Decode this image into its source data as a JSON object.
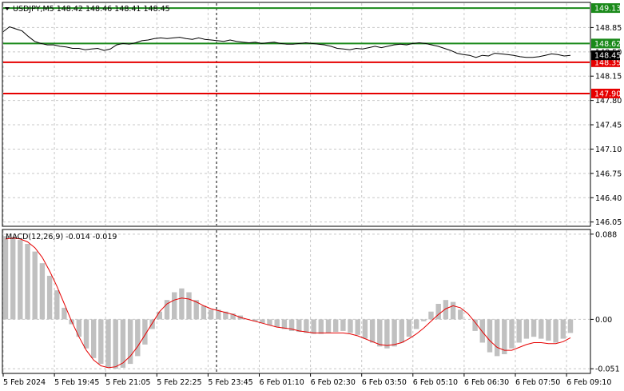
{
  "header": {
    "symbol_line": "USDJPY,M5  148.42 148.46 148.41 148.45",
    "macd_label": "MACD(12,26,9) -0.014 -0.019"
  },
  "colors": {
    "price_line": "#000000",
    "green_level": "#1a8a1a",
    "red_level": "#e60000",
    "histogram": "#c0c0c0",
    "signal_line": "#e60000",
    "grid": "#c8c8c8",
    "current_price_tag": "#000000"
  },
  "price_axis": {
    "ticks": [
      "148.85",
      "148.50",
      "148.15",
      "147.80",
      "147.45",
      "147.10",
      "146.75",
      "146.40",
      "146.05"
    ]
  },
  "macd_axis": {
    "ticks": [
      "0.088",
      "0.00",
      "-0.051"
    ]
  },
  "time_axis": {
    "labels": [
      "5 Feb 2024",
      "5 Feb 19:45",
      "5 Feb 21:05",
      "5 Feb 22:25",
      "5 Feb 23:45",
      "6 Feb 01:10",
      "6 Feb 02:30",
      "6 Feb 03:50",
      "6 Feb 05:10",
      "6 Feb 06:30",
      "6 Feb 07:50",
      "6 Feb 09:10"
    ]
  },
  "levels": {
    "green": [
      "149.13",
      "148.62"
    ],
    "red": [
      "148.35",
      "147.90"
    ],
    "current_price": "148.45"
  },
  "chart_data": {
    "type": "line",
    "series": [
      {
        "values": [
          148.79,
          148.86,
          148.83,
          148.8,
          148.72,
          148.65,
          148.62,
          148.6,
          148.6,
          148.58,
          148.57,
          148.55,
          148.55,
          148.53,
          148.54,
          148.55,
          148.52,
          148.54,
          148.6,
          148.62,
          148.61,
          148.63,
          148.66,
          148.67,
          148.69,
          148.7,
          148.69,
          148.7,
          148.71,
          148.69,
          148.68,
          148.7,
          148.68,
          148.67,
          148.66,
          148.65,
          148.67,
          148.65,
          148.64,
          148.63,
          148.64,
          148.62,
          148.63,
          148.64,
          148.62,
          148.61,
          148.61,
          148.62,
          148.63,
          148.62,
          148.61,
          148.6,
          148.58,
          148.55,
          148.54,
          148.53,
          148.55,
          148.54,
          148.56,
          148.58,
          148.56,
          148.58,
          148.6,
          148.61,
          148.6,
          148.62,
          148.63,
          148.62,
          148.6,
          148.58,
          148.55,
          148.52,
          148.48,
          148.46,
          148.45,
          148.42,
          148.45,
          148.44,
          148.48,
          148.47,
          148.46,
          148.45,
          148.43,
          148.42,
          148.42,
          148.43,
          148.45,
          148.47,
          148.46,
          148.44,
          148.45
        ]
      }
    ],
    "macd_histogram": [
      0.086,
      0.085,
      0.082,
      0.078,
      0.07,
      0.058,
      0.045,
      0.03,
      0.012,
      -0.005,
      -0.018,
      -0.03,
      -0.04,
      -0.046,
      -0.05,
      -0.051,
      -0.05,
      -0.046,
      -0.038,
      -0.026,
      -0.01,
      0.008,
      0.02,
      0.028,
      0.032,
      0.028,
      0.02,
      0.014,
      0.01,
      0.01,
      0.008,
      0.006,
      0.004,
      0.0,
      -0.002,
      -0.004,
      -0.006,
      -0.008,
      -0.01,
      -0.012,
      -0.013,
      -0.014,
      -0.015,
      -0.015,
      -0.014,
      -0.013,
      -0.012,
      -0.014,
      -0.016,
      -0.02,
      -0.024,
      -0.028,
      -0.03,
      -0.028,
      -0.024,
      -0.018,
      -0.01,
      -0.002,
      0.008,
      0.016,
      0.02,
      0.018,
      0.01,
      0.0,
      -0.012,
      -0.024,
      -0.034,
      -0.038,
      -0.036,
      -0.03,
      -0.024,
      -0.02,
      -0.018,
      -0.02,
      -0.022,
      -0.024,
      -0.02,
      -0.014
    ],
    "macd_signal": [
      0.083,
      0.084,
      0.083,
      0.08,
      0.074,
      0.064,
      0.05,
      0.034,
      0.016,
      -0.002,
      -0.018,
      -0.032,
      -0.042,
      -0.048,
      -0.05,
      -0.049,
      -0.045,
      -0.038,
      -0.028,
      -0.016,
      -0.004,
      0.008,
      0.016,
      0.02,
      0.022,
      0.021,
      0.018,
      0.014,
      0.011,
      0.009,
      0.007,
      0.005,
      0.002,
      0.0,
      -0.002,
      -0.004,
      -0.006,
      -0.008,
      -0.009,
      -0.01,
      -0.012,
      -0.013,
      -0.014,
      -0.014,
      -0.014,
      -0.014,
      -0.014,
      -0.015,
      -0.017,
      -0.02,
      -0.023,
      -0.026,
      -0.027,
      -0.026,
      -0.024,
      -0.02,
      -0.015,
      -0.009,
      -0.002,
      0.005,
      0.011,
      0.014,
      0.012,
      0.006,
      -0.003,
      -0.013,
      -0.022,
      -0.029,
      -0.032,
      -0.032,
      -0.029,
      -0.026,
      -0.024,
      -0.024,
      -0.025,
      -0.025,
      -0.023,
      -0.019
    ],
    "ylim_price": [
      146.0,
      149.2
    ],
    "ylim_macd": [
      -0.055,
      0.092
    ],
    "grid": true
  }
}
